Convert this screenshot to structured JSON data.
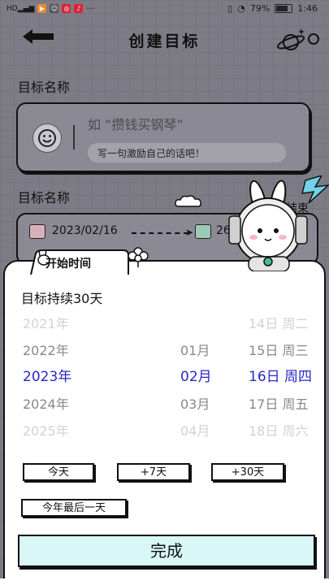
{
  "status_bar": {
    "battery": "79%",
    "time": "1:46",
    "dots": "···"
  },
  "header": {
    "title": "创建目标"
  },
  "goal_name": {
    "label": "目标名称",
    "placeholder": "如 “攒钱买钢琴”",
    "motto_hint": "写一句激励自己的话吧！"
  },
  "date_section": {
    "label": "目标名称",
    "start_date": "2023/02/16",
    "end_date_partial": "26",
    "start_tag": "开始时间",
    "end_tag_partial": "结束"
  },
  "picker": {
    "duration_label": "目标持续30天",
    "years": [
      "2021年",
      "2022年",
      "2023年",
      "2024年",
      "2025年"
    ],
    "months": [
      "",
      "01月",
      "02月",
      "03月",
      "04月"
    ],
    "days": [
      "14日 周二",
      "15日 周三",
      "16日 周四",
      "17日 周五",
      "18日 周六"
    ],
    "selected_index": 2
  },
  "quick_buttons": {
    "today": "今天",
    "plus7": "+7天",
    "plus30": "+30天",
    "year_end": "今年最后一天"
  },
  "done_label": "完成",
  "colors": {
    "selected": "#2727c8",
    "done_bg": "#d9f7f7",
    "page_bg": "#7d7c86"
  }
}
